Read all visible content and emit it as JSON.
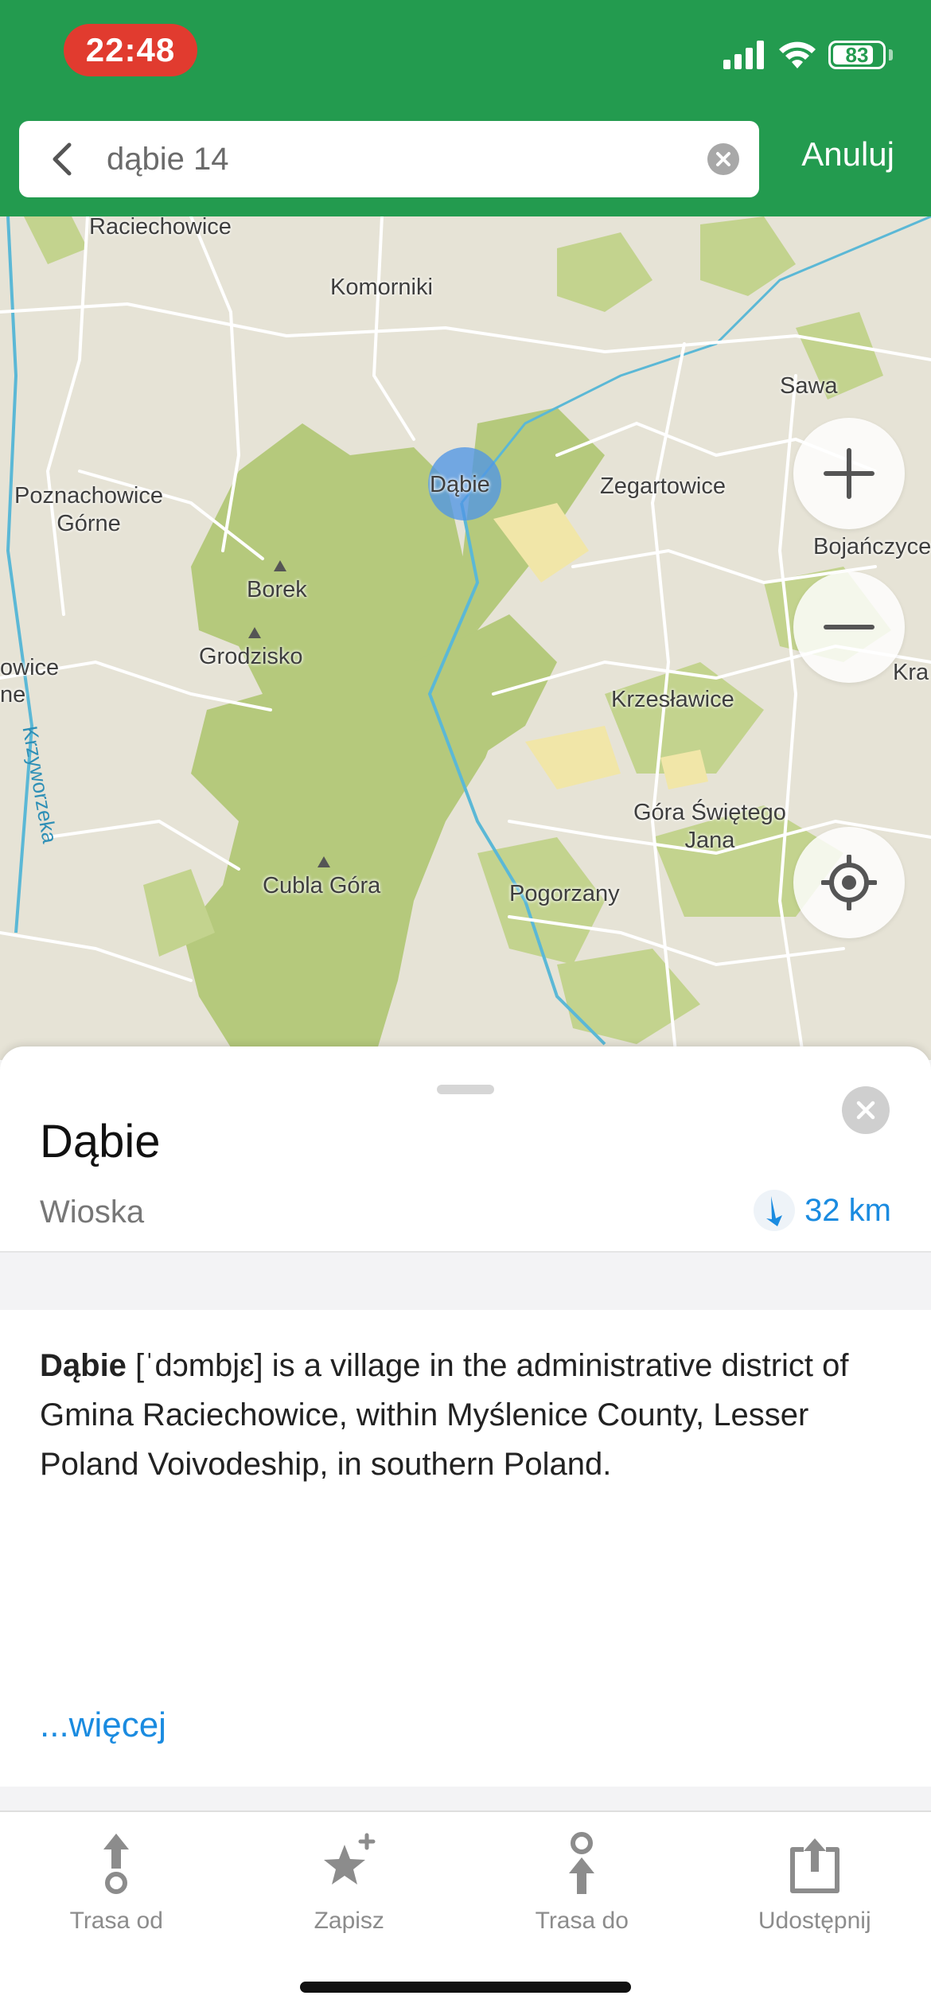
{
  "status_bar": {
    "time": "22:48",
    "battery": "83",
    "battery_level": 0.83,
    "icons": [
      "signal-icon",
      "wifi-icon",
      "battery-icon"
    ]
  },
  "search": {
    "query": "dąbie 14",
    "cancel_label": "Anuluj"
  },
  "map": {
    "labels": {
      "raciechowice": "Raciechowice",
      "komorniki": "Komorniki",
      "sawa": "Sawa",
      "poznachowice": "Poznachowice\nGórne",
      "dabie": "Dąbie",
      "zegartowice": "Zegartowice",
      "bojanczyce": "Bojańczyce",
      "borek": "Borek",
      "grodzisko": "Grodzisko",
      "owice": "owice",
      "ne": "ne",
      "kra": "Kra",
      "krzeslawice": "Krzesławice",
      "krzyworzeka": "Krzyworzeka",
      "gora_swietego_jana": "Góra Świętego\nJana",
      "cubla_gora": "Cubla Góra",
      "pogorzany": "Pogorzany"
    },
    "colors": {
      "land": "#e6e3d6",
      "forest": "#b5c97c",
      "water": "#5bb8d6",
      "road": "#ffffff"
    }
  },
  "place": {
    "title": "Dąbie",
    "type": "Wioska",
    "distance": "32 km",
    "description_bold": "Dąbie",
    "description_rest": " [ˈdɔmbjɛ] is a village in the administrative district of Gmina Raciechowice, within Myślenice County, Lesser Poland Voivodeship, in southern Poland.",
    "more_label": "...więcej"
  },
  "toolbar": {
    "route_from": "Trasa od",
    "save": "Zapisz",
    "route_to": "Trasa do",
    "share": "Udostępnij"
  },
  "colors": {
    "header": "#239b4f",
    "accent": "#1a8be0",
    "time_pill": "#e13b2f"
  }
}
